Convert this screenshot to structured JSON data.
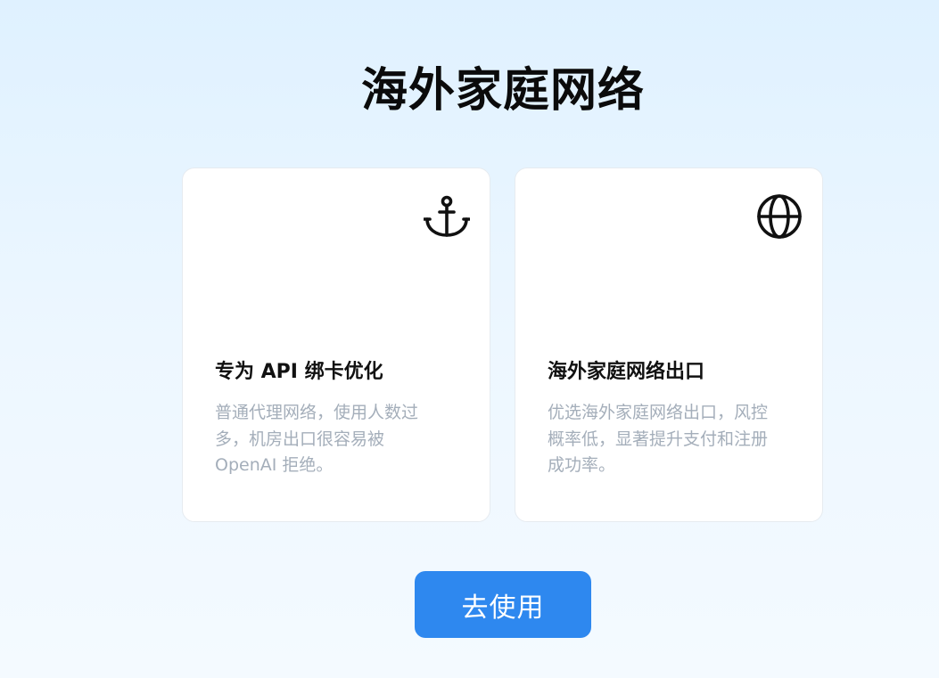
{
  "page": {
    "title": "海外家庭网络"
  },
  "cards": [
    {
      "icon": "anchor-icon",
      "heading": "专为 API 绑卡优化",
      "description": "普通代理网络，使用人数过多，机房出口很容易被 OpenAI 拒绝。"
    },
    {
      "icon": "globe-icon",
      "heading": "海外家庭网络出口",
      "description": "优选海外家庭网络出口，风控概率低，显著提升支付和注册成功率。"
    }
  ],
  "cta": {
    "label": "去使用"
  },
  "colors": {
    "accent": "#2e88ef",
    "heading": "#111111",
    "muted_text": "#a4aeba"
  }
}
